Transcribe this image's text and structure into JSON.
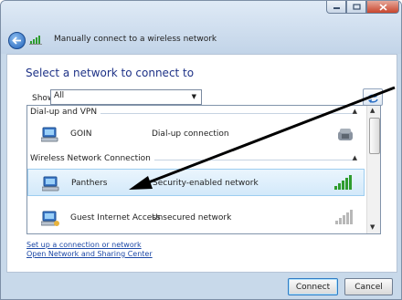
{
  "window": {
    "title": "Manually connect to a wireless network",
    "controls": [
      "minimize",
      "maximize",
      "close"
    ]
  },
  "main": {
    "heading": "Select a network to connect to",
    "show_label": "Show",
    "show_value": "All"
  },
  "network_list": {
    "groups": [
      {
        "label": "Dial-up and VPN",
        "items": [
          {
            "name": "GOIN",
            "description": "Dial-up connection",
            "icon": "dialup-icon"
          }
        ]
      },
      {
        "label": "Wireless Network Connection",
        "items": [
          {
            "name": "Panthers",
            "description": "Security-enabled network",
            "signal_bars": 5,
            "selected": true
          },
          {
            "name": "Guest Internet Access",
            "description": "Unsecured network",
            "signal_bars": 5,
            "selected": false
          }
        ]
      }
    ]
  },
  "links": {
    "setup": "Set up a connection or network",
    "sharing": "Open Network and Sharing Center"
  },
  "buttons": {
    "connect": "Connect",
    "cancel": "Cancel"
  },
  "colors": {
    "heading": "#1e3287",
    "link": "#1c48a6",
    "selection": "#d3e9fa",
    "signal_active": "#2e9c2e",
    "signal_inactive": "#b8b8b8",
    "annotation_arrow": "#000000"
  }
}
